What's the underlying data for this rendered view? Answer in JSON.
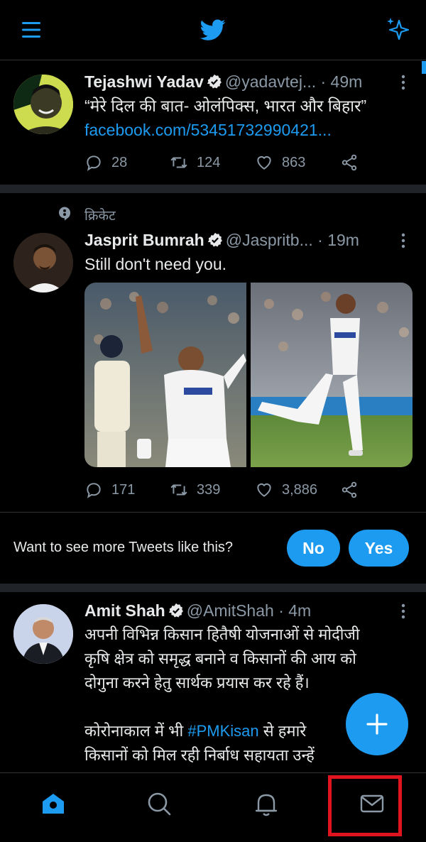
{
  "colors": {
    "accent": "#1d9bf0",
    "background": "#000000",
    "highlight": "#e0141e"
  },
  "topbar": {
    "menu_icon": "hamburger-icon",
    "logo_icon": "twitter-bird-icon",
    "sparkle_icon": "sparkle-icon"
  },
  "tweets": [
    {
      "name": "Tejashwi Yadav",
      "handle": "@yadavtej...",
      "time": "· 49m",
      "text": "“मेरे दिल की बात- ओलंपिक्स, भारत और बिहार”",
      "link": "facebook.com/53451732990421...",
      "replies": "28",
      "retweets": "124",
      "likes": "863"
    },
    {
      "social_context": "क्रिकेट",
      "name": "Jasprit Bumrah",
      "handle": "@Jaspritb...",
      "time": "· 19m",
      "text": "Still don't need you.",
      "replies": "171",
      "retweets": "339",
      "likes": "3,886"
    },
    {
      "name": "Amit Shah",
      "handle": "@AmitShah",
      "time": "· 4m",
      "text_lines": [
        "अपनी विभिन्न किसान हितैषी योजनाओं से मोदीजी",
        "कृषि क्षेत्र को समृद्ध बनाने व किसानों की आय को",
        "दोगुना करने हेतु सार्थक प्रयास कर रहे हैं।"
      ],
      "text_line4_pre": "कोरोनाकाल में भी ",
      "hashtag": "#PMKisan",
      "text_line4_post": " से हमारे",
      "text_line5": "किसानों को मिल रही निर्बाध सहायता उन्हें"
    }
  ],
  "prompt": {
    "question": "Want to see more Tweets like this?",
    "no_label": "No",
    "yes_label": "Yes"
  },
  "bottom_nav": [
    "home-icon",
    "search-icon",
    "notifications-icon",
    "messages-icon"
  ]
}
